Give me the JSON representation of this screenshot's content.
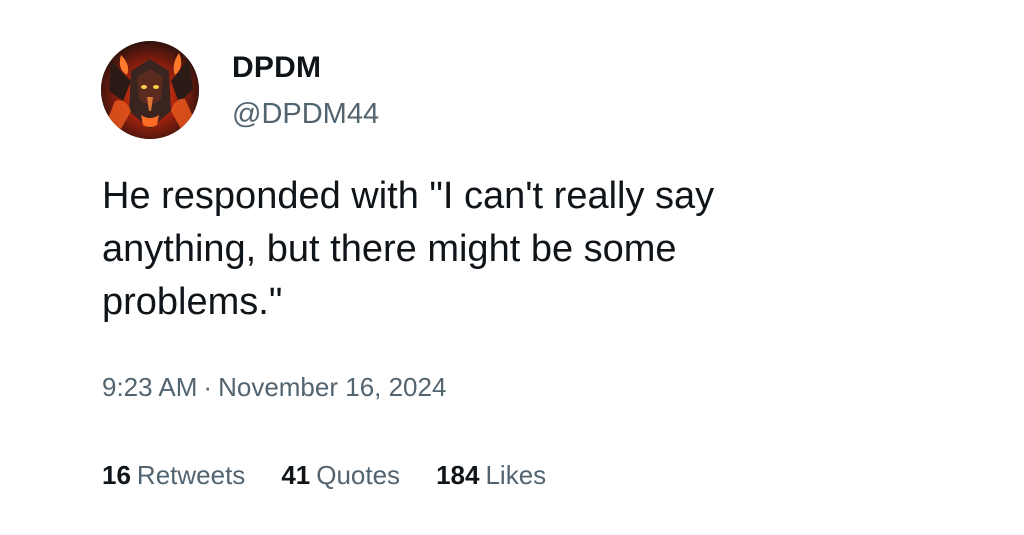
{
  "author": {
    "display_name": "DPDM",
    "handle": "@DPDM44",
    "avatar_icon": "demon-avatar"
  },
  "tweet": {
    "text": "He responded with \"I can't really say anything, but there might be some problems.\"",
    "time": "9:23 AM",
    "separator": "·",
    "date": "November 16, 2024"
  },
  "stats": {
    "retweets_count": "16",
    "retweets_label": "Retweets",
    "quotes_count": "41",
    "quotes_label": "Quotes",
    "likes_count": "184",
    "likes_label": "Likes"
  },
  "colors": {
    "text_primary": "#0f1419",
    "text_secondary": "#536471",
    "background": "#ffffff"
  }
}
